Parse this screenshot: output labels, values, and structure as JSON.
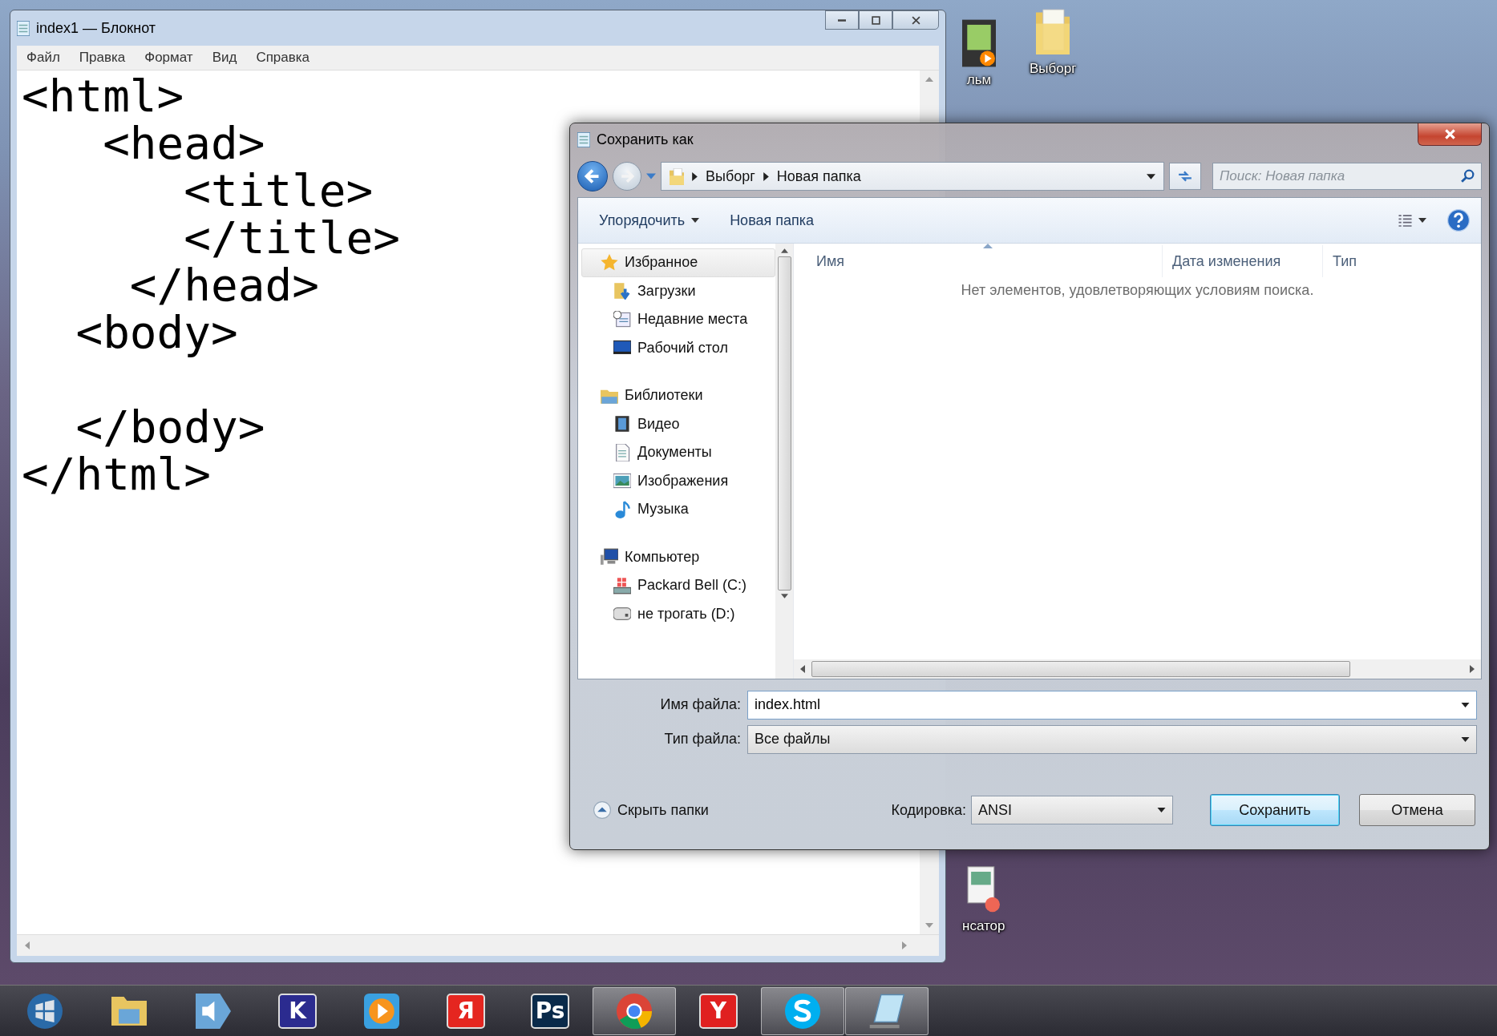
{
  "desktop": {
    "icons": [
      {
        "label": "льм",
        "kind": "video"
      },
      {
        "label": "Выборг",
        "kind": "folder"
      },
      {
        "label": "нсатор",
        "kind": "document"
      }
    ]
  },
  "notepad": {
    "title": "index1 — Блокнот",
    "menu": [
      "Файл",
      "Правка",
      "Формат",
      "Вид",
      "Справка"
    ],
    "content": "<html>\n   <head>\n      <title>\n      </title>\n    </head>\n  <body>\n\n  </body>\n</html>"
  },
  "dialog": {
    "title": "Сохранить как",
    "breadcrumb": [
      "Выборг",
      "Новая папка"
    ],
    "search": {
      "placeholder": "Поиск: Новая папка"
    },
    "toolbar": {
      "organize": "Упорядочить",
      "new_folder": "Новая папка"
    },
    "nav": [
      {
        "label": "Избранное",
        "kind": "star",
        "selected": true,
        "children": [
          {
            "label": "Загрузки",
            "kind": "downloads",
            "selected": false
          },
          {
            "label": "Недавние места",
            "kind": "recent",
            "selected": false
          },
          {
            "label": "Рабочий стол",
            "kind": "desktop",
            "selected": false
          }
        ]
      },
      {
        "label": "Библиотеки",
        "kind": "libraries",
        "selected": false,
        "children": [
          {
            "label": "Видео",
            "kind": "video",
            "selected": false
          },
          {
            "label": "Документы",
            "kind": "documents",
            "selected": false
          },
          {
            "label": "Изображения",
            "kind": "pictures",
            "selected": false
          },
          {
            "label": "Музыка",
            "kind": "music",
            "selected": false
          }
        ]
      },
      {
        "label": "Компьютер",
        "kind": "computer",
        "selected": false,
        "children": [
          {
            "label": "Packard Bell (C:)",
            "kind": "system",
            "selected": false
          },
          {
            "label": "не трогать (D:)",
            "kind": "drive",
            "selected": false
          }
        ]
      }
    ],
    "columns": [
      "Имя",
      "Дата изменения",
      "Тип"
    ],
    "empty_message": "Нет элементов, удовлетворяющих условиям поиска.",
    "filename": {
      "label": "Имя файла:",
      "value": "index.html"
    },
    "filetype": {
      "label": "Тип файла:",
      "value": "Все файлы"
    },
    "hide_folders": "Скрыть папки",
    "encoding": {
      "label": "Кодировка:",
      "value": "ANSI"
    },
    "buttons": [
      {
        "label": "Сохранить",
        "default": true
      },
      {
        "label": "Отмена",
        "default": false
      }
    ]
  },
  "taskbar": [
    {
      "kind": "start",
      "active": false
    },
    {
      "kind": "folder",
      "active": false
    },
    {
      "kind": "speaker",
      "active": false
    },
    {
      "kind": "letter",
      "glyph": "K",
      "color": "#2b2b8f",
      "active": false
    },
    {
      "kind": "player",
      "active": false
    },
    {
      "kind": "letter",
      "glyph": "Я",
      "color": "#e52620",
      "active": false
    },
    {
      "kind": "letter",
      "glyph": "Ps",
      "color": "#0a2a4a",
      "active": false
    },
    {
      "kind": "chrome",
      "active": true
    },
    {
      "kind": "letter",
      "glyph": "Y",
      "color": "#e02020",
      "active": false
    },
    {
      "kind": "skype",
      "active": true
    },
    {
      "kind": "notepad",
      "active": true
    }
  ]
}
